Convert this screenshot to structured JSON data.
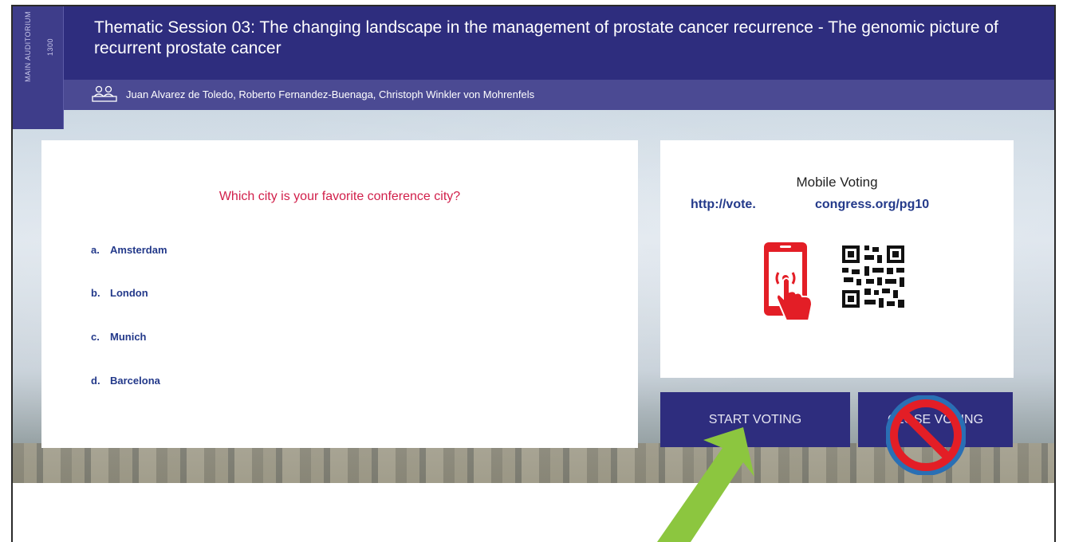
{
  "sidebar": {
    "room": "MAIN AUDITORIUM",
    "time": "1300"
  },
  "session": {
    "title": "Thematic Session 03: The changing landscape in the management of prostate cancer recurrence -  The genomic picture of recurrent prostate cancer",
    "presenters": "Juan Alvarez de Toledo, Roberto Fernandez-Buenaga, Christoph Winkler von Mohrenfels"
  },
  "poll": {
    "question": "Which city is your favorite conference city?",
    "options": [
      {
        "letter": "a.",
        "label": "Amsterdam"
      },
      {
        "letter": "b.",
        "label": "London"
      },
      {
        "letter": "c.",
        "label": "Munich"
      },
      {
        "letter": "d.",
        "label": "Barcelona"
      }
    ]
  },
  "mobile_voting": {
    "title": "Mobile Voting",
    "url_part1": "http://vote.",
    "url_part2": "congress.org/pg10",
    "icons": [
      "phone-touch-icon",
      "qr-code-icon"
    ]
  },
  "buttons": {
    "start": "START VOTING",
    "close": "CLOSE VOTING"
  },
  "annotations": {
    "arrow_color": "#8cc63f",
    "no_symbol_color": "#e31e26",
    "no_symbol_ring": "#2a6fb4"
  },
  "colors": {
    "header": "#2e2d7e",
    "question": "#d11f4a",
    "option": "#23398a"
  }
}
